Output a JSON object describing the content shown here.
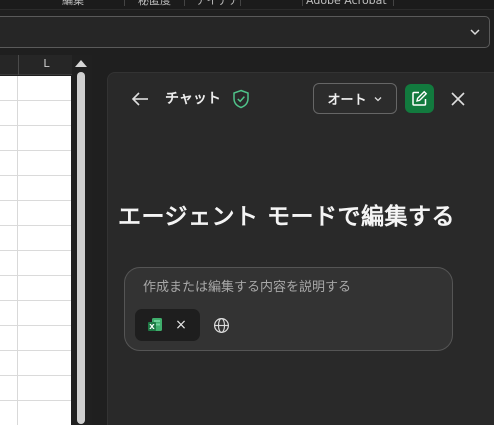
{
  "ribbon": {
    "labels": [
      "編集",
      "秘匿度",
      "アイデア",
      "Adobe Acrobat"
    ]
  },
  "sheet": {
    "column_header": "L"
  },
  "copilot": {
    "title": "チャット",
    "mode_label": "オート",
    "heading": "エージェント モードで編集する",
    "input_placeholder": "作成または編集する内容を説明する",
    "chip_remove_glyph": "×",
    "accent_color": "#127a3e",
    "icons": [
      "back-arrow-icon",
      "shield-check-icon",
      "chevron-down-icon",
      "new-chat-icon",
      "close-icon",
      "excel-file-icon",
      "globe-icon"
    ]
  }
}
